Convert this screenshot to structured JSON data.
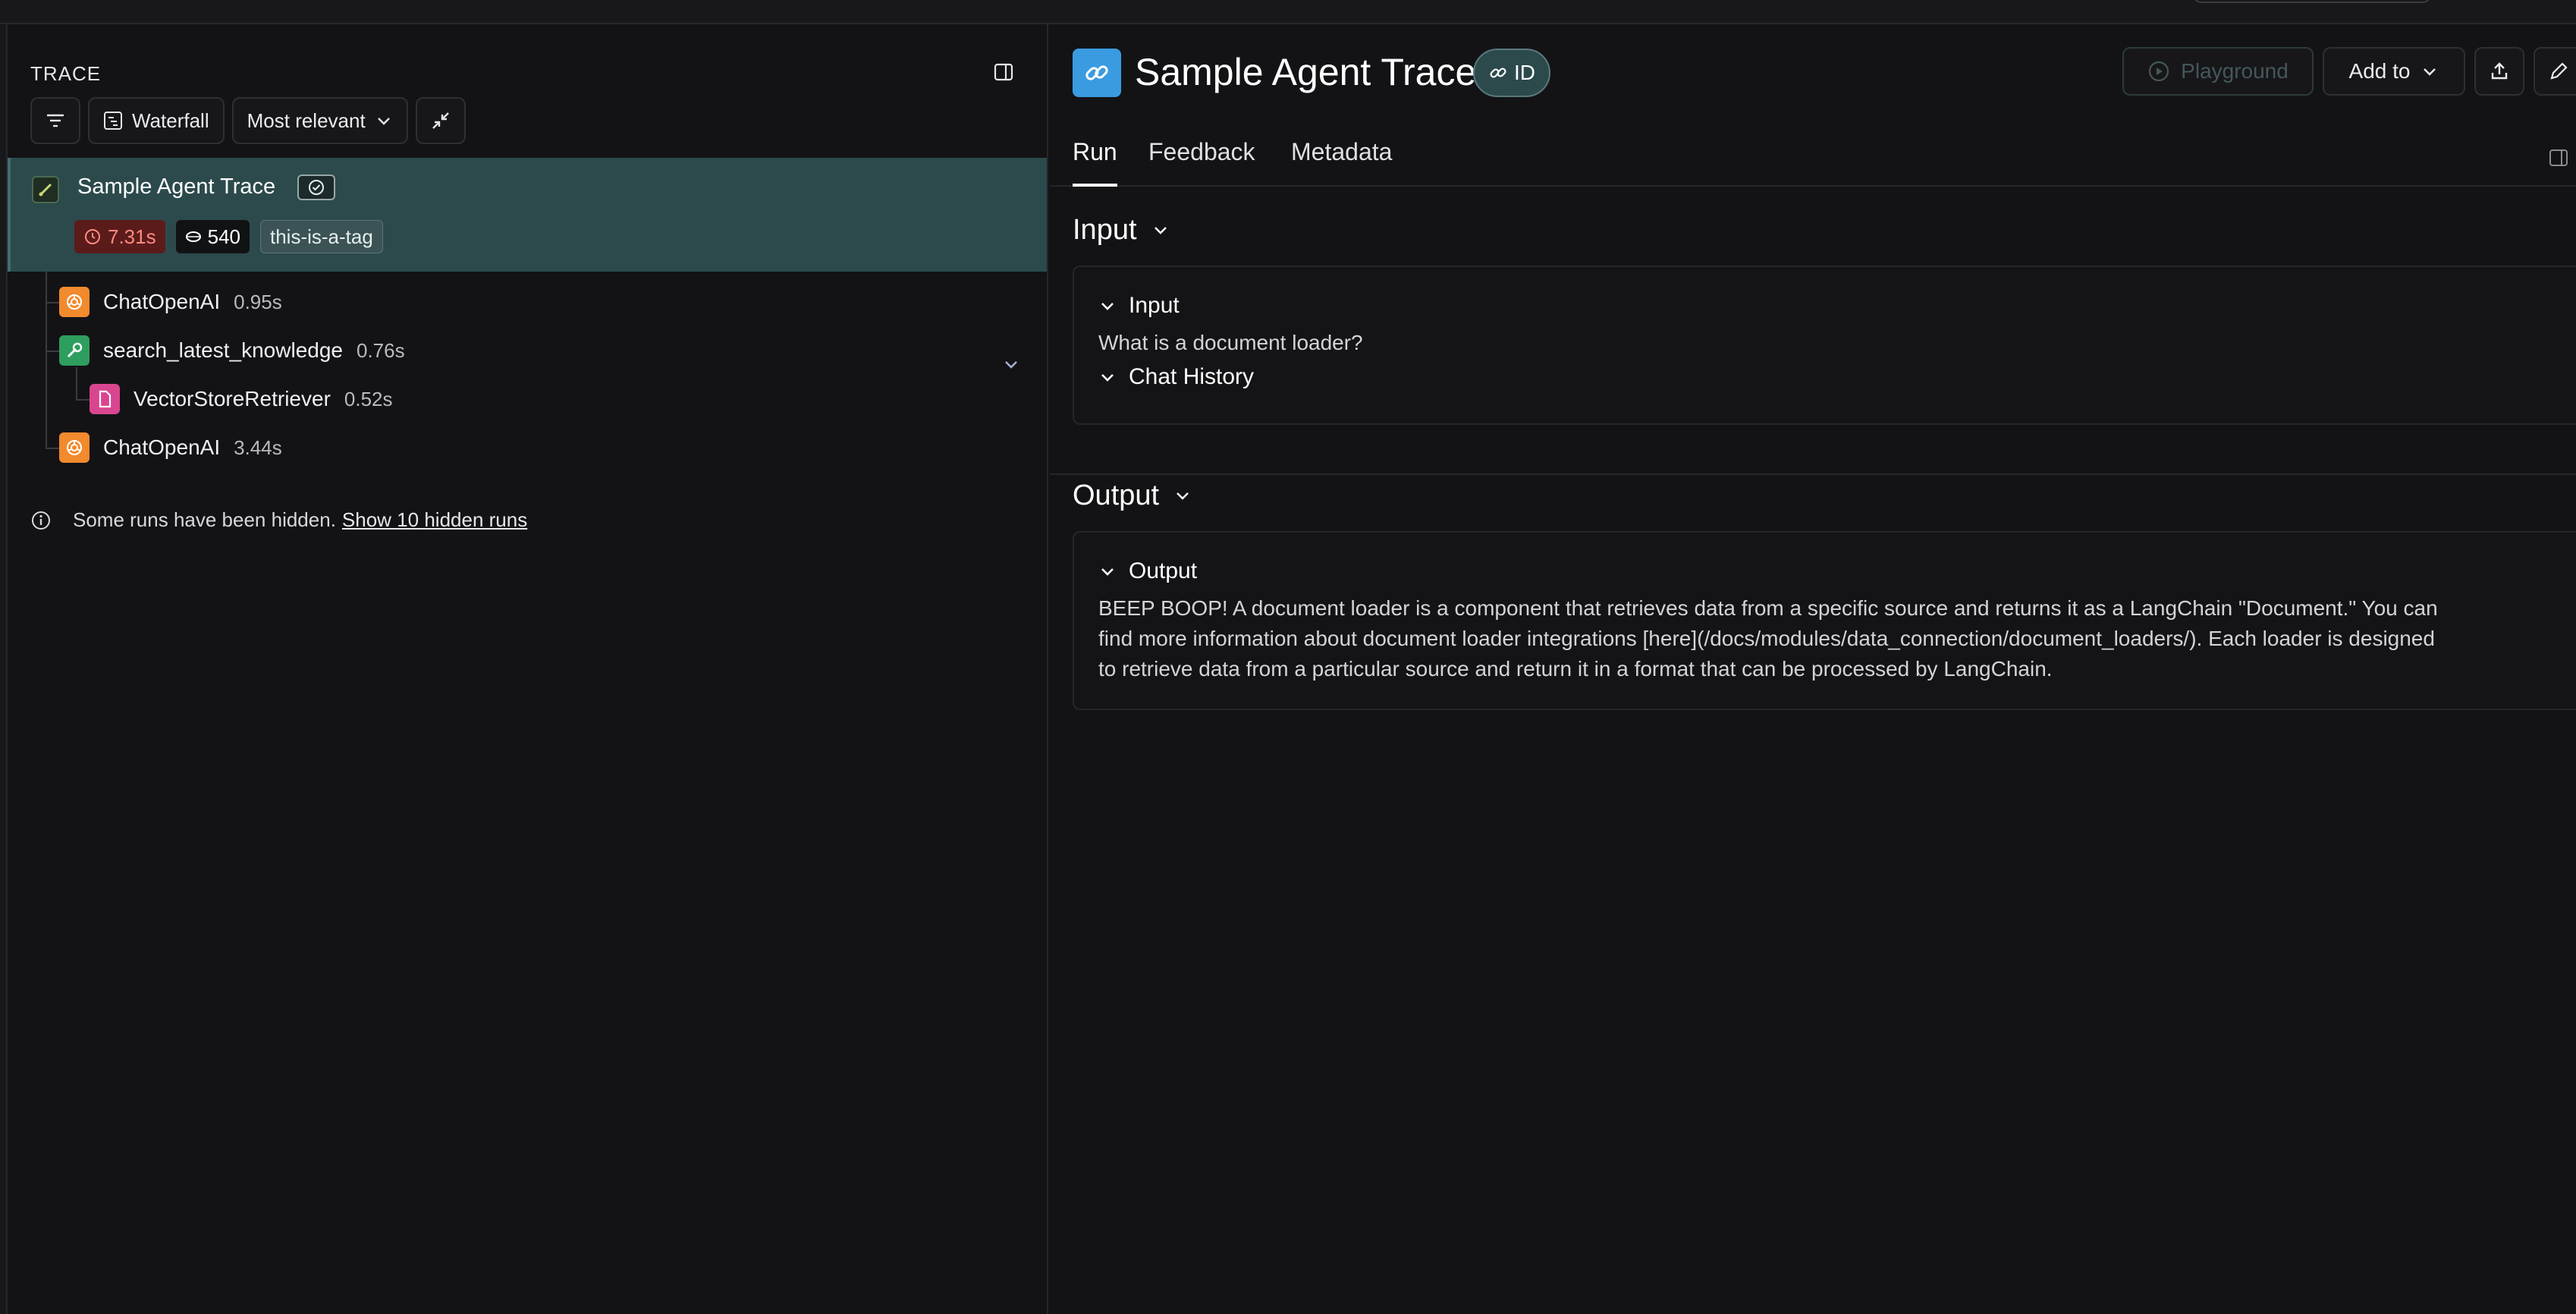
{
  "trace_panel": {
    "title": "TRACE",
    "toolbar": {
      "view_label": "Waterfall",
      "sort_label": "Most relevant"
    },
    "root_run": {
      "name": "Sample Agent Trace",
      "latency": "7.31s",
      "tokens": "540",
      "tag": "this-is-a-tag",
      "status": "success"
    },
    "children": [
      {
        "name": "ChatOpenAI",
        "time": "0.95s",
        "type": "llm"
      },
      {
        "name": "search_latest_knowledge",
        "time": "0.76s",
        "type": "tool"
      },
      {
        "name": "VectorStoreRetriever",
        "time": "0.52s",
        "type": "retriever"
      },
      {
        "name": "ChatOpenAI",
        "time": "3.44s",
        "type": "llm"
      }
    ],
    "hidden_note": {
      "text": "Some runs have been hidden.",
      "link": "Show 10 hidden runs"
    }
  },
  "run_panel": {
    "title": "Sample Agent Trace",
    "id_label": "ID",
    "actions": {
      "playground": "Playground",
      "add_to": "Add to"
    },
    "tabs": [
      "Run",
      "Feedback",
      "Metadata"
    ],
    "input": {
      "section_title": "Input",
      "sub_label": "Input",
      "value": "What is a document loader?",
      "chat_history_label": "Chat History"
    },
    "output": {
      "section_title": "Output",
      "sub_label": "Output",
      "line1": "BEEP BOOP! A document loader is a component that retrieves data from a specific source and returns it as a LangChain \"Document.\" You can",
      "line2": "find more information about document loader integrations [here](/docs/modules/data_connection/document_loaders/). Each loader is designed",
      "line3": "to retrieve data from a particular source and return it in a format that can be processed by LangChain."
    }
  },
  "colors": {
    "background": "#131316",
    "selected_row": "#2c4a4c",
    "llm_icon": "#f28a2e",
    "tool_icon": "#2e9e5e",
    "retriever_icon": "#d9468f",
    "chain_icon": "#3b9be0",
    "latency_badge": "#5b1b1b"
  }
}
